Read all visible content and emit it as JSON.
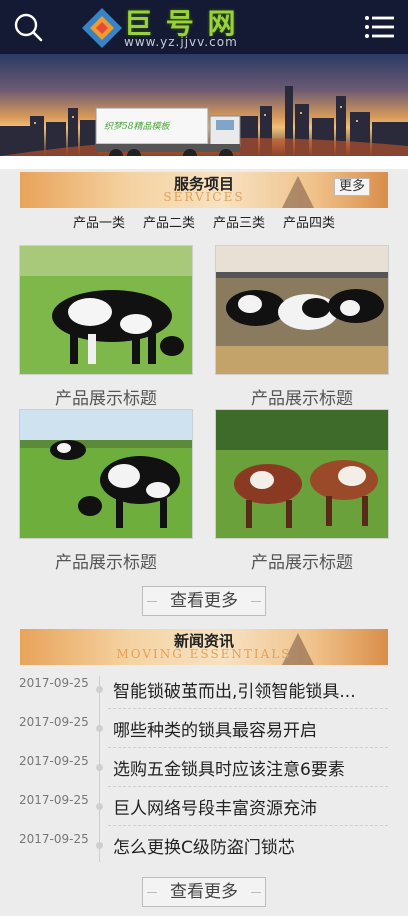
{
  "header": {
    "logo_text": "巨 号 网",
    "logo_sub": "www.yz.jjvv.com",
    "search_icon": "search-icon",
    "menu_icon": "menu-icon"
  },
  "banner": {
    "truck_text": "织梦58精品模板"
  },
  "services": {
    "title": "服务项目",
    "subtitle": "SERVICES",
    "more": "更多",
    "tabs": [
      "产品一类",
      "产品二类",
      "产品三类",
      "产品四类"
    ],
    "products": [
      {
        "caption": "产品展示标题"
      },
      {
        "caption": "产品展示标题"
      },
      {
        "caption": "产品展示标题"
      },
      {
        "caption": "产品展示标题"
      }
    ],
    "view_more": "查看更多"
  },
  "news": {
    "title": "新闻资讯",
    "subtitle": "MOVING ESSENTIALS",
    "items": [
      {
        "date": "2017-09-25",
        "title": "智能锁破茧而出,引领智能锁具..."
      },
      {
        "date": "2017-09-25",
        "title": "哪些种类的锁具最容易开启"
      },
      {
        "date": "2017-09-25",
        "title": "选购五金锁具时应该注意6要素"
      },
      {
        "date": "2017-09-25",
        "title": "巨人网络号段丰富资源充沛"
      },
      {
        "date": "2017-09-25",
        "title": "怎么更换C级防盗门锁芯"
      }
    ],
    "view_more": "查看更多"
  },
  "colors": {
    "header_bg": "#141a33",
    "page_bg": "#ececec",
    "section_bar": "#f0c28a"
  }
}
